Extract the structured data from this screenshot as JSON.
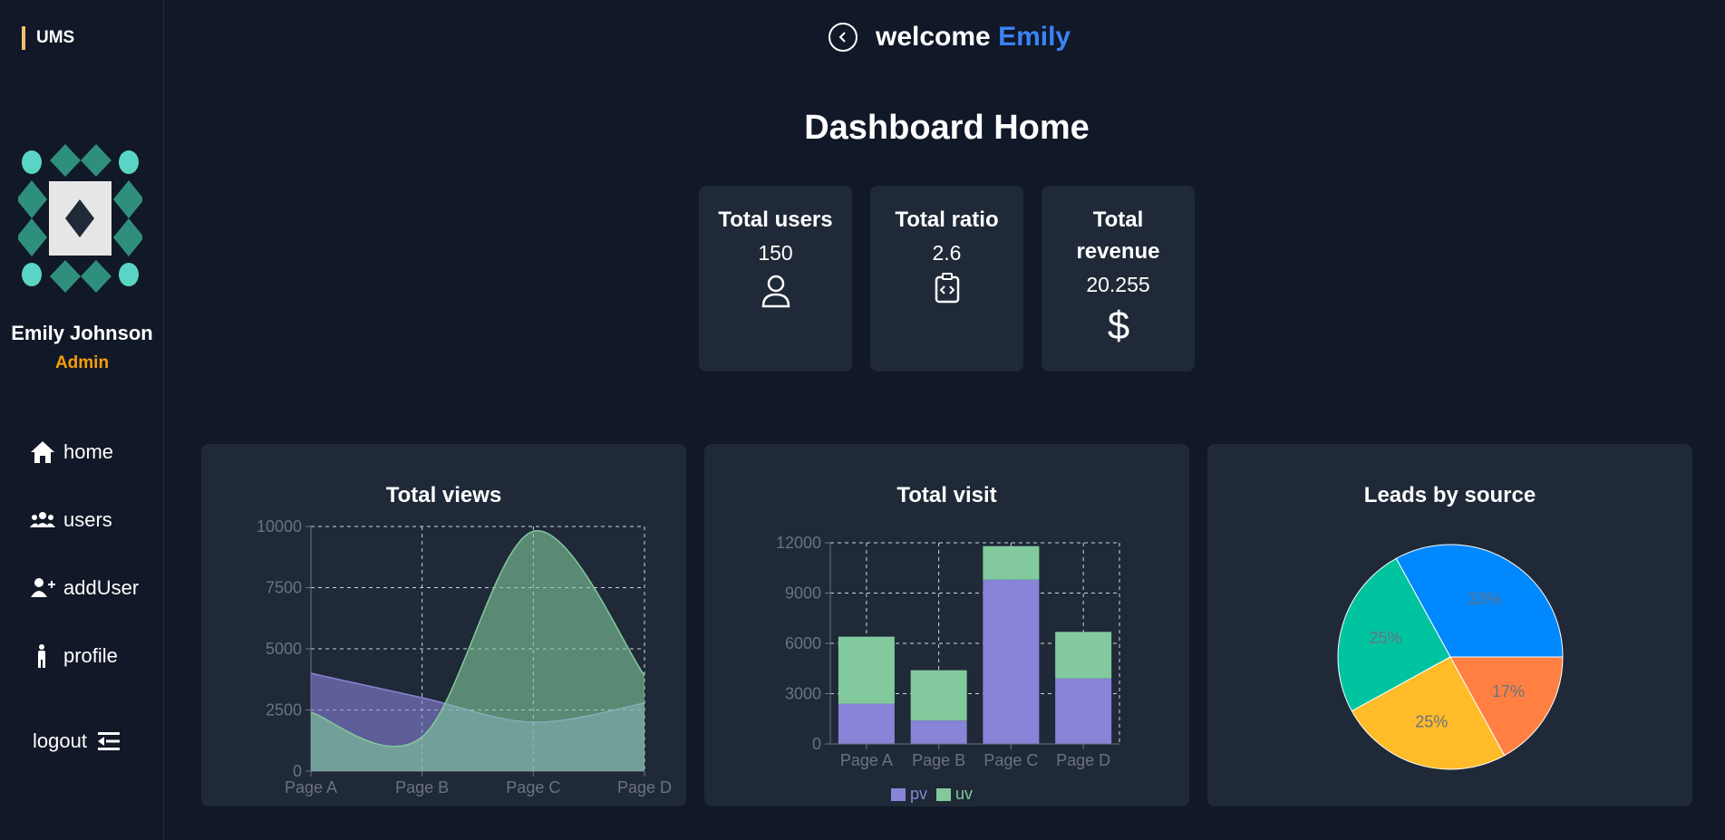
{
  "sidebar": {
    "brand": "UMS",
    "user_name": "Emily Johnson",
    "user_role": "Admin",
    "nav": [
      {
        "label": "home",
        "icon": "home-icon"
      },
      {
        "label": "users",
        "icon": "users-icon"
      },
      {
        "label": "addUser",
        "icon": "add-user-icon"
      },
      {
        "label": "profile",
        "icon": "person-icon"
      }
    ],
    "logout_label": "logout"
  },
  "header": {
    "welcome": "welcome",
    "name": "Emily"
  },
  "page_title": "Dashboard Home",
  "stats": [
    {
      "title": "Total users",
      "value": "150",
      "icon": "user-icon"
    },
    {
      "title": "Total ratio",
      "value": "2.6",
      "icon": "clipboard-code-icon"
    },
    {
      "title": "Total revenue",
      "value": "20.255",
      "icon": "dollar-icon"
    }
  ],
  "colors": {
    "accent": "#3b82f6",
    "role": "#f59e0b",
    "pv": "#8884d8",
    "uv": "#82ca9d",
    "pie": [
      "#0088FE",
      "#00C49F",
      "#FFBB28",
      "#FF8042"
    ]
  },
  "chart_data": [
    {
      "type": "area",
      "title": "Total views",
      "categories": [
        "Page A",
        "Page B",
        "Page C",
        "Page D"
      ],
      "series": [
        {
          "values": [
            4000,
            3000,
            2000,
            2780
          ]
        },
        {
          "values": [
            2400,
            1398,
            9800,
            3908
          ]
        }
      ],
      "ylim": [
        0,
        10000
      ],
      "yticks": [
        0,
        2500,
        5000,
        7500,
        10000
      ],
      "grid": true
    },
    {
      "type": "bar",
      "stacked": true,
      "title": "Total visit",
      "categories": [
        "Page A",
        "Page B",
        "Page C",
        "Page D"
      ],
      "series": [
        {
          "name": "pv",
          "values": [
            2400,
            1398,
            9800,
            3908
          ]
        },
        {
          "name": "uv",
          "values": [
            4000,
            3000,
            2000,
            2780
          ]
        }
      ],
      "ylim": [
        0,
        12000
      ],
      "yticks": [
        0,
        3000,
        6000,
        9000,
        12000
      ],
      "grid": true,
      "legend": "bottom"
    },
    {
      "type": "pie",
      "title": "Leads by source",
      "values": [
        33,
        25,
        25,
        17
      ],
      "labels": [
        "33%",
        "25%",
        "25%",
        "17%"
      ]
    }
  ]
}
